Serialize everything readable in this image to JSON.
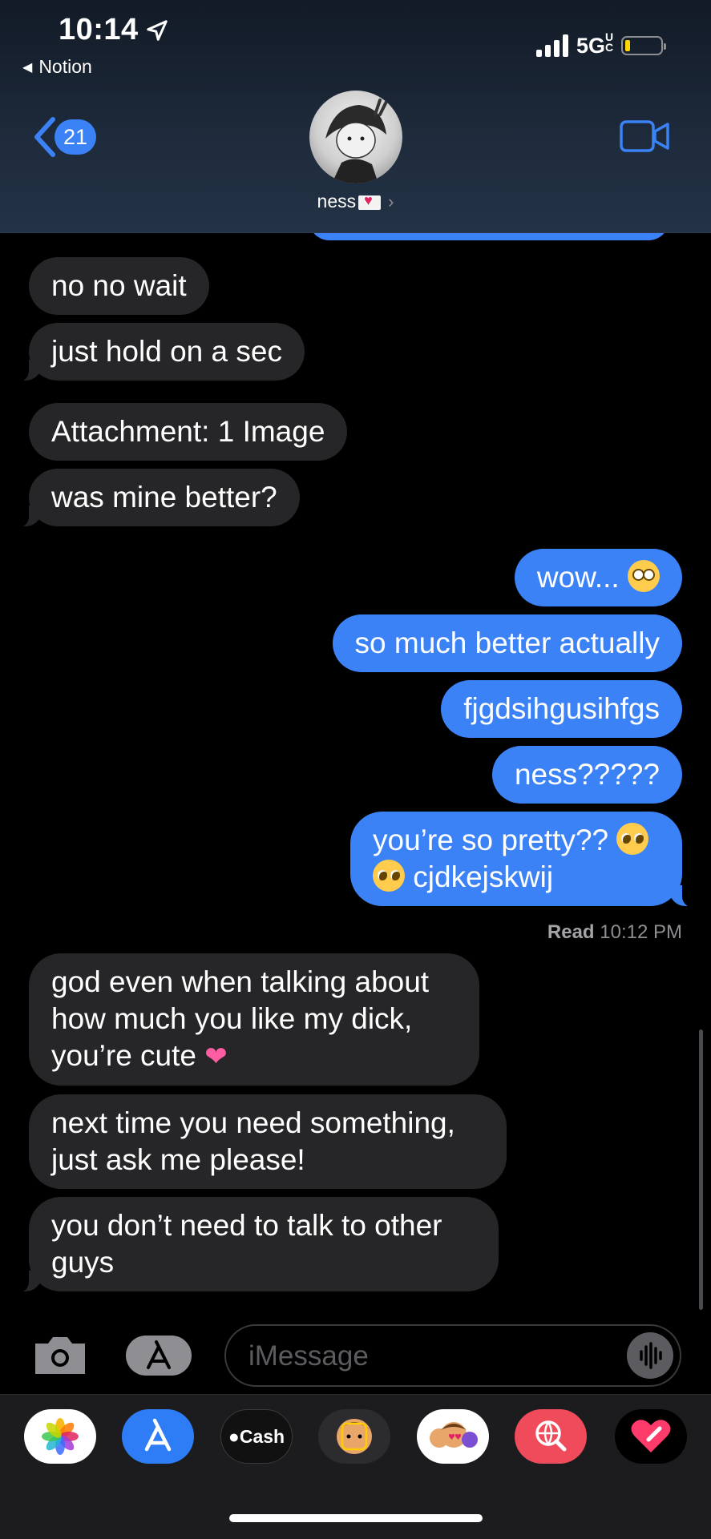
{
  "status_bar": {
    "time": "10:14",
    "back_app": "Notion",
    "network": "5G",
    "network_suffix": "UC"
  },
  "header": {
    "unread_count": "21",
    "contact_name": "ness"
  },
  "messages": [
    {
      "text": "no no wait",
      "from": "them"
    },
    {
      "text": "just hold on a sec",
      "from": "them"
    },
    {
      "text": "Attachment: 1 Image",
      "from": "them"
    },
    {
      "text": "was mine better?",
      "from": "them"
    },
    {
      "text": "wow...",
      "from": "me"
    },
    {
      "text": "so much better actually",
      "from": "me"
    },
    {
      "text": "fjgdsihgusihfgs",
      "from": "me"
    },
    {
      "text": "ness?????",
      "from": "me"
    },
    {
      "text_a": "you’re so pretty??",
      "text_b": "cjdkejskwij",
      "from": "me"
    },
    {
      "text": "god even when talking about how much you like my dick, you’re cute",
      "from": "them"
    },
    {
      "text": "next time you need something, just ask me please!",
      "from": "them"
    },
    {
      "text": "you don’t need to talk to other guys",
      "from": "them"
    }
  ],
  "read_receipt": {
    "label": "Read",
    "time": "10:12 PM"
  },
  "composer": {
    "placeholder": "iMessage"
  },
  "app_tray": {
    "cash_label": "Cash"
  },
  "colors": {
    "outgoing": "#3b82f6",
    "incoming": "#262628",
    "background": "#000000"
  }
}
